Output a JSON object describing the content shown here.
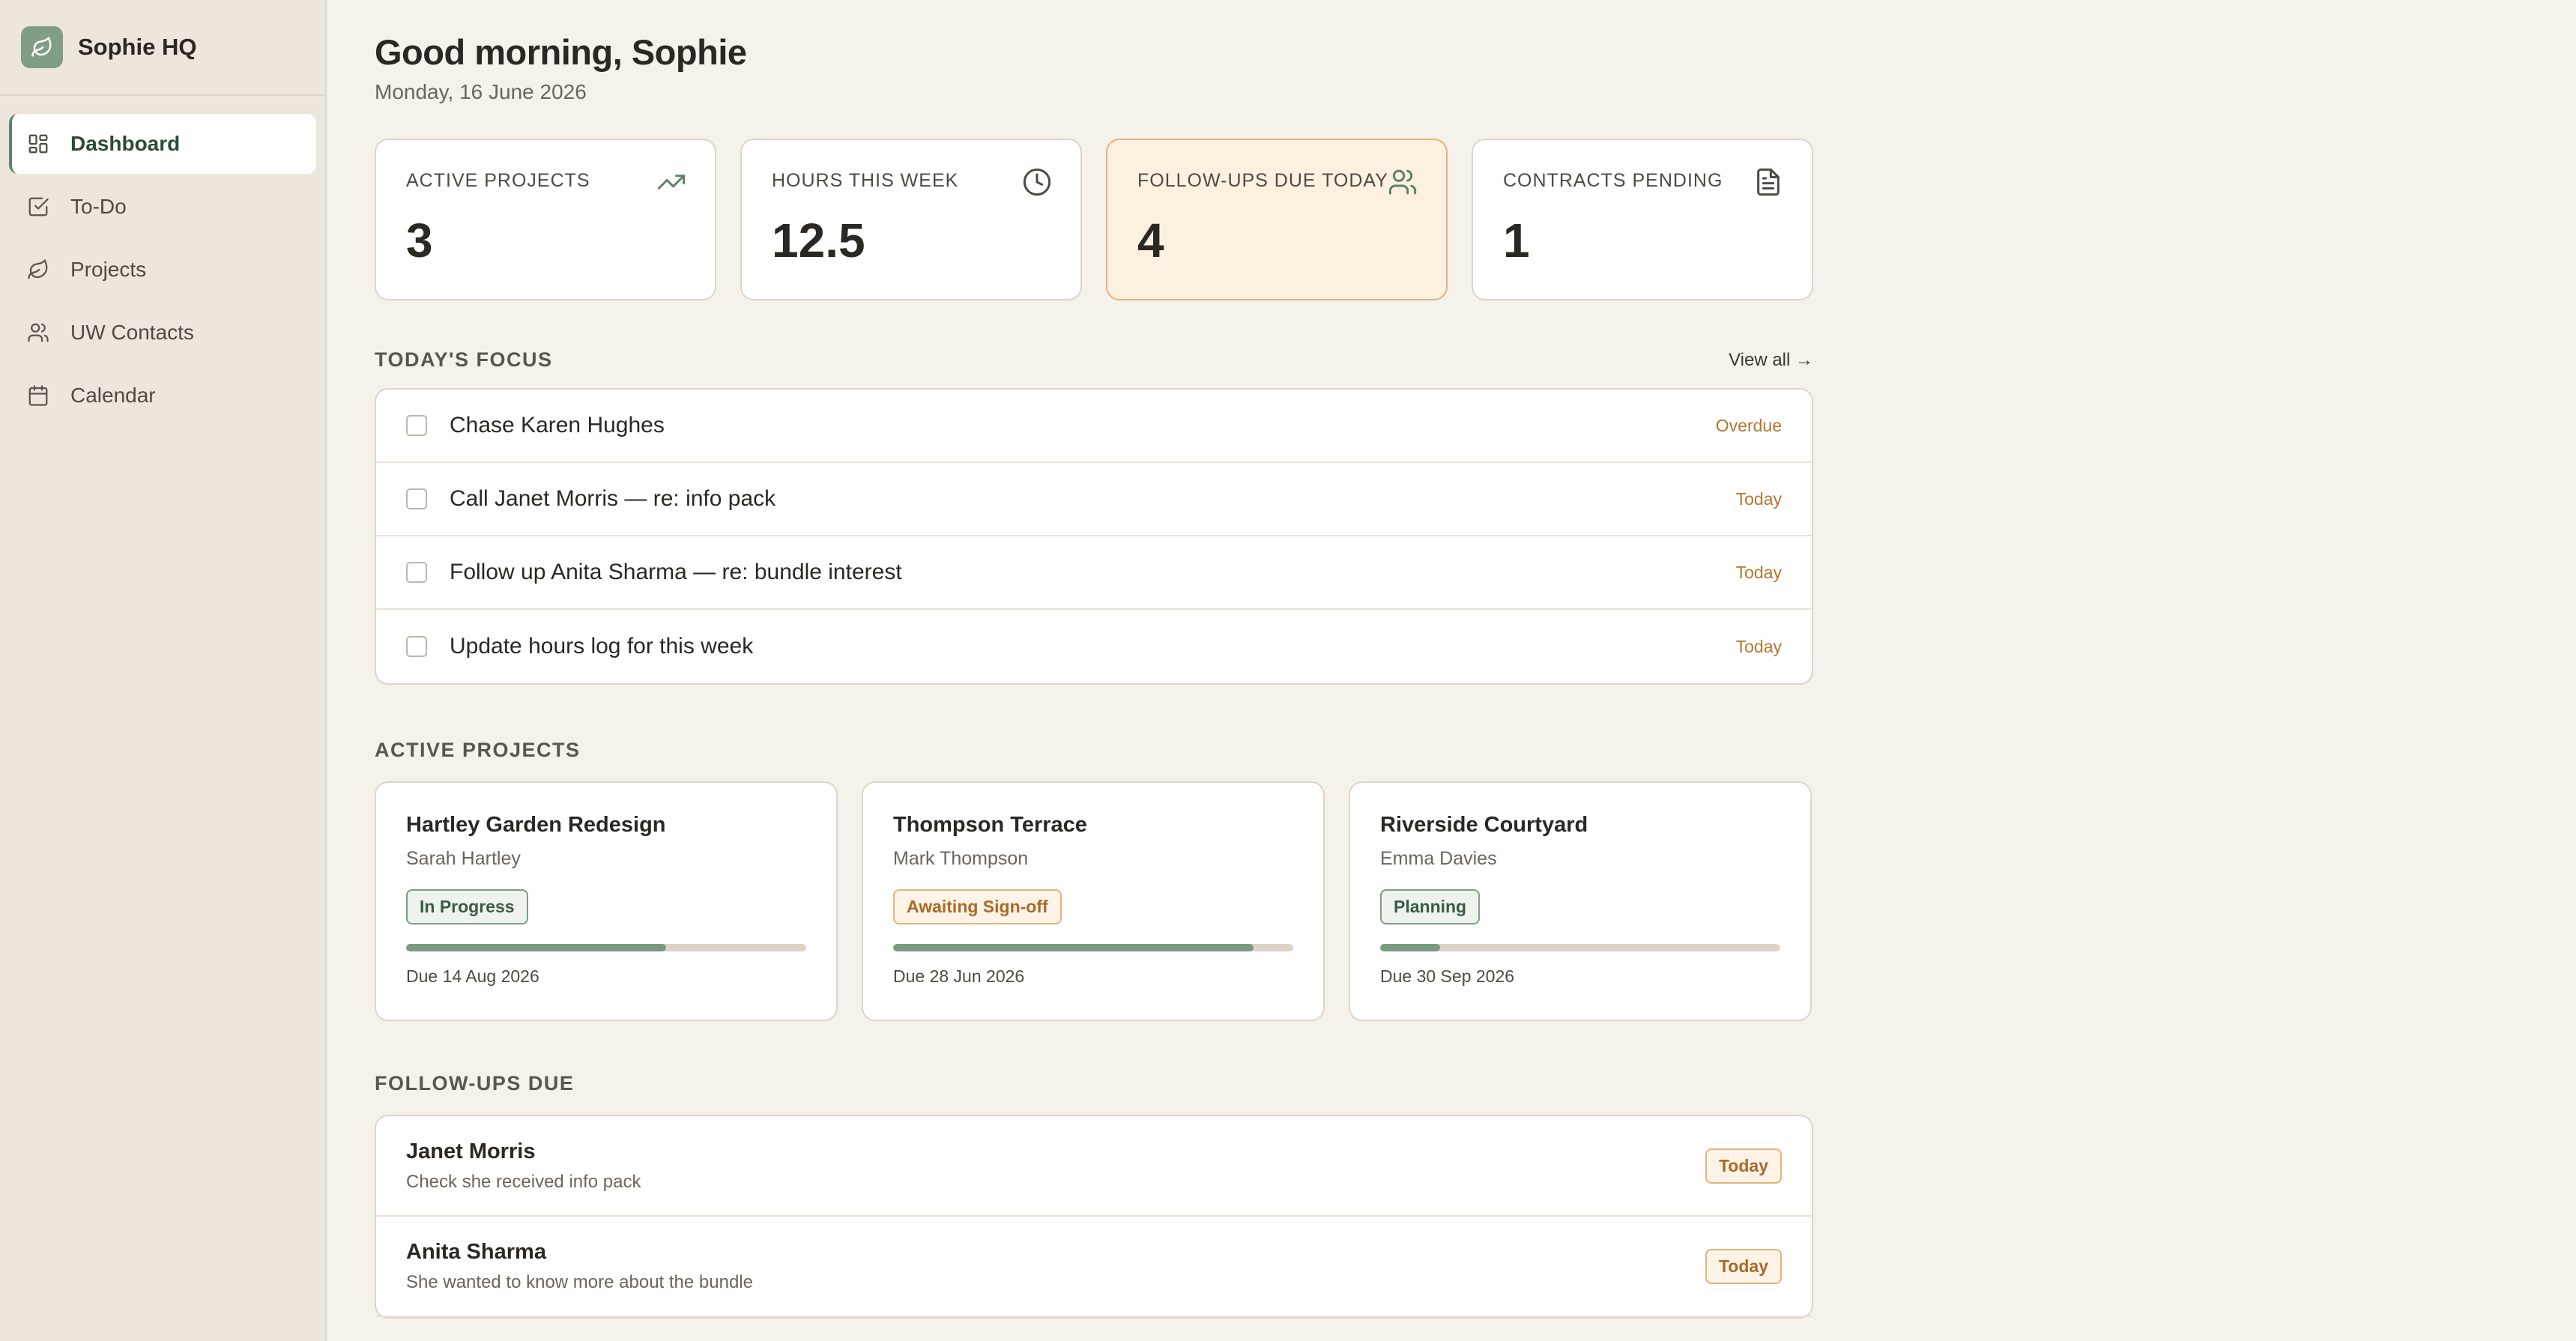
{
  "app": {
    "name": "Sophie HQ",
    "logo_icon": "leaf-icon"
  },
  "sidebar": {
    "items": [
      {
        "label": "Dashboard",
        "icon": "dashboard-icon",
        "active": true
      },
      {
        "label": "To-Do",
        "icon": "checkbox-icon",
        "active": false
      },
      {
        "label": "Projects",
        "icon": "leaf-icon",
        "active": false
      },
      {
        "label": "UW Contacts",
        "icon": "users-icon",
        "active": false
      },
      {
        "label": "Calendar",
        "icon": "calendar-icon",
        "active": false
      }
    ]
  },
  "header": {
    "greeting": "Good morning, Sophie",
    "date": "Monday, 16 June 2026"
  },
  "stats": [
    {
      "label": "ACTIVE PROJECTS",
      "value": "3",
      "icon": "trending-up-icon"
    },
    {
      "label": "HOURS THIS WEEK",
      "value": "12.5",
      "icon": "clock-icon"
    },
    {
      "label": "FOLLOW-UPS DUE TODAY",
      "value": "4",
      "icon": "users-icon",
      "highlighted": true
    },
    {
      "label": "CONTRACTS PENDING",
      "value": "1",
      "icon": "document-icon"
    }
  ],
  "focus": {
    "title": "TODAY'S FOCUS",
    "view_all": "View all →",
    "items": [
      {
        "text": "Chase Karen Hughes",
        "tag": "Overdue"
      },
      {
        "text": "Call Janet Morris — re: info pack",
        "tag": "Today"
      },
      {
        "text": "Follow up Anita Sharma — re: bundle interest",
        "tag": "Today"
      },
      {
        "text": "Update hours log for this week",
        "tag": "Today"
      }
    ]
  },
  "projects": {
    "title": "ACTIVE PROJECTS",
    "items": [
      {
        "name": "Hartley Garden Redesign",
        "client": "Sarah Hartley",
        "status": "In Progress",
        "status_tone": "green",
        "progress": 0.65,
        "due": "Due 14 Aug 2026"
      },
      {
        "name": "Thompson Terrace",
        "client": "Mark Thompson",
        "status": "Awaiting Sign-off",
        "status_tone": "orange",
        "progress": 0.9,
        "due": "Due 28 Jun 2026"
      },
      {
        "name": "Riverside Courtyard",
        "client": "Emma Davies",
        "status": "Planning",
        "status_tone": "green",
        "progress": 0.15,
        "due": "Due 30 Sep 2026"
      }
    ]
  },
  "followups": {
    "title": "FOLLOW-UPS DUE",
    "items": [
      {
        "name": "Janet Morris",
        "note": "Check she received info pack",
        "tag": "Today"
      },
      {
        "name": "Anita Sharma",
        "note": "She wanted to know more about the bundle",
        "tag": "Today"
      }
    ]
  },
  "colors": {
    "accent": "#7f9e85",
    "highlight_bg": "#fcf0df",
    "warning": "#b5762f",
    "background": "#f5f1eb"
  }
}
